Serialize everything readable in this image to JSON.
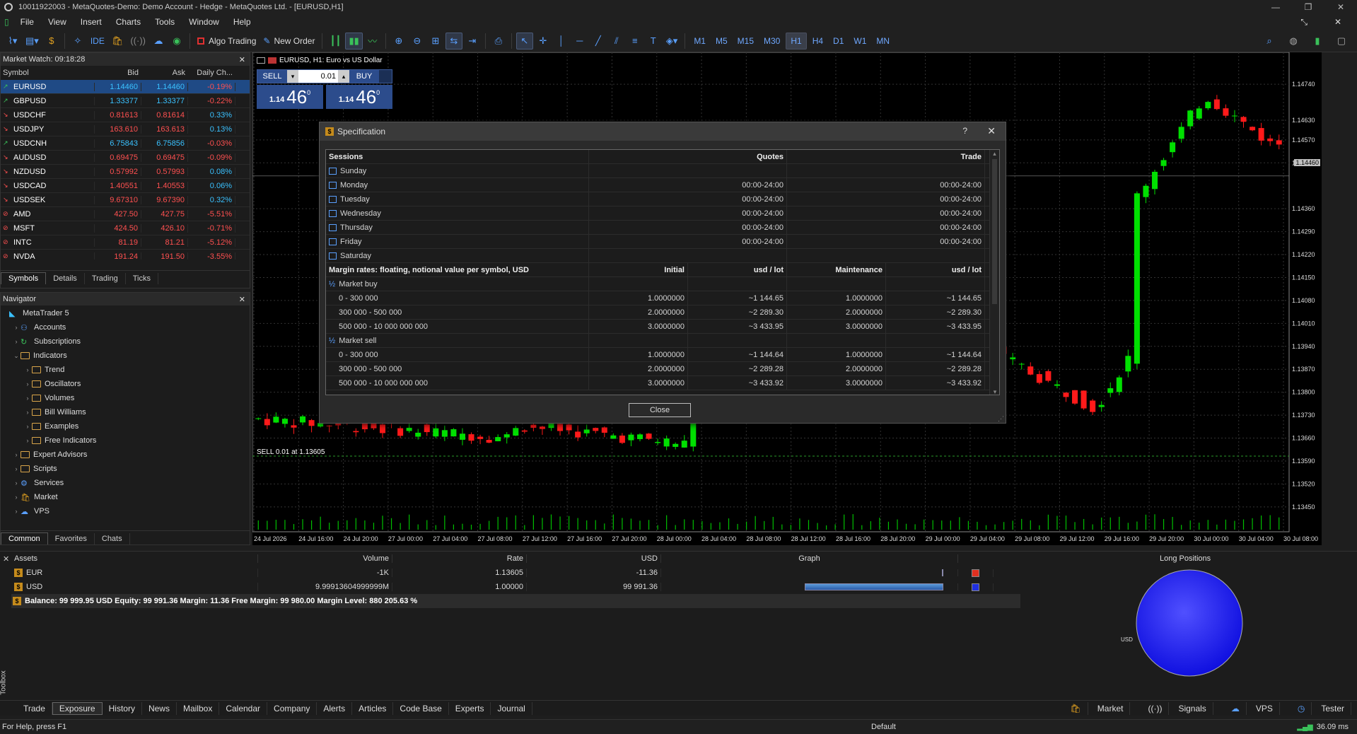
{
  "window": {
    "title": "10011922003 - MetaQuotes-Demo: Demo Account - Hedge - MetaQuotes Ltd. - [EURUSD,H1]"
  },
  "menu": [
    "File",
    "View",
    "Insert",
    "Charts",
    "Tools",
    "Window",
    "Help"
  ],
  "toolbar": {
    "algo_trading": "Algo Trading",
    "new_order": "New Order",
    "ide": "IDE",
    "timeframes": [
      "M1",
      "M5",
      "M15",
      "M30",
      "H1",
      "H4",
      "D1",
      "W1",
      "MN"
    ],
    "active_timeframe": "H1"
  },
  "market_watch": {
    "title": "Market Watch: 09:18:28",
    "columns": [
      "Symbol",
      "Bid",
      "Ask",
      "Daily Ch..."
    ],
    "rows": [
      {
        "symbol": "EURUSD",
        "bid": "1.14460",
        "ask": "1.14460",
        "change": "-0.19%",
        "dir": "up",
        "chg": "dn"
      },
      {
        "symbol": "GBPUSD",
        "bid": "1.33377",
        "ask": "1.33377",
        "change": "-0.22%",
        "dir": "up",
        "chg": "dn"
      },
      {
        "symbol": "USDCHF",
        "bid": "0.81613",
        "ask": "0.81614",
        "change": "0.33%",
        "dir": "dn",
        "chg": "up"
      },
      {
        "symbol": "USDJPY",
        "bid": "163.610",
        "ask": "163.613",
        "change": "0.13%",
        "dir": "dn",
        "chg": "up"
      },
      {
        "symbol": "USDCNH",
        "bid": "6.75843",
        "ask": "6.75856",
        "change": "-0.03%",
        "dir": "up",
        "chg": "dn"
      },
      {
        "symbol": "AUDUSD",
        "bid": "0.69475",
        "ask": "0.69475",
        "change": "-0.09%",
        "dir": "dn",
        "chg": "dn"
      },
      {
        "symbol": "NZDUSD",
        "bid": "0.57992",
        "ask": "0.57993",
        "change": "0.08%",
        "dir": "dn",
        "chg": "up"
      },
      {
        "symbol": "USDCAD",
        "bid": "1.40551",
        "ask": "1.40553",
        "change": "0.06%",
        "dir": "dn",
        "chg": "up"
      },
      {
        "symbol": "USDSEK",
        "bid": "9.67310",
        "ask": "9.67390",
        "change": "0.32%",
        "dir": "dn",
        "chg": "up"
      },
      {
        "symbol": "AMD",
        "bid": "427.50",
        "ask": "427.75",
        "change": "-5.51%",
        "dir": "stop",
        "chg": "dn"
      },
      {
        "symbol": "MSFT",
        "bid": "424.50",
        "ask": "426.10",
        "change": "-0.71%",
        "dir": "stop",
        "chg": "dn"
      },
      {
        "symbol": "INTC",
        "bid": "81.19",
        "ask": "81.21",
        "change": "-5.12%",
        "dir": "stop",
        "chg": "dn"
      },
      {
        "symbol": "NVDA",
        "bid": "191.24",
        "ask": "191.50",
        "change": "-3.55%",
        "dir": "stop",
        "chg": "dn"
      }
    ],
    "tabs": [
      "Symbols",
      "Details",
      "Trading",
      "Ticks"
    ]
  },
  "navigator": {
    "title": "Navigator",
    "items": [
      {
        "label": "MetaTrader 5",
        "depth": 0,
        "kind": "root"
      },
      {
        "label": "Accounts",
        "depth": 1,
        "kind": "accounts"
      },
      {
        "label": "Subscriptions",
        "depth": 1,
        "kind": "subs"
      },
      {
        "label": "Indicators",
        "depth": 1,
        "kind": "folder",
        "open": true
      },
      {
        "label": "Trend",
        "depth": 2,
        "kind": "folder"
      },
      {
        "label": "Oscillators",
        "depth": 2,
        "kind": "folder"
      },
      {
        "label": "Volumes",
        "depth": 2,
        "kind": "folder"
      },
      {
        "label": "Bill Williams",
        "depth": 2,
        "kind": "folder"
      },
      {
        "label": "Examples",
        "depth": 2,
        "kind": "folder"
      },
      {
        "label": "Free Indicators",
        "depth": 2,
        "kind": "folder"
      },
      {
        "label": "Expert Advisors",
        "depth": 1,
        "kind": "folder"
      },
      {
        "label": "Scripts",
        "depth": 1,
        "kind": "folder"
      },
      {
        "label": "Services",
        "depth": 1,
        "kind": "services"
      },
      {
        "label": "Market",
        "depth": 1,
        "kind": "market"
      },
      {
        "label": "VPS",
        "depth": 1,
        "kind": "vps"
      }
    ],
    "tabs": [
      "Common",
      "Favorites",
      "Chats"
    ]
  },
  "chart": {
    "label": "EURUSD, H1:  Euro vs US Dollar",
    "sell_label": "SELL",
    "buy_label": "BUY",
    "lot": "0.01",
    "sell_big": "46",
    "sell_small": "1.14",
    "sell_sup": "0",
    "buy_big": "46",
    "buy_small": "1.14",
    "buy_sup": "0",
    "position_label": "SELL 0.01 at 1.13605",
    "current_price": "1.14460",
    "price_ticks": [
      "1.14740",
      "1.14630",
      "1.14570",
      "1.14500",
      "1.14460",
      "1.14360",
      "1.14290",
      "1.14220",
      "1.14150",
      "1.14080",
      "1.14010",
      "1.13940",
      "1.13870",
      "1.13800",
      "1.13730",
      "1.13660",
      "1.13590",
      "1.13520",
      "1.13450"
    ],
    "time_ticks": [
      "24 Jul 2026",
      "24 Jul 16:00",
      "24 Jul 20:00",
      "27 Jul 00:00",
      "27 Jul 04:00",
      "27 Jul 08:00",
      "27 Jul 12:00",
      "27 Jul 16:00",
      "27 Jul 20:00",
      "28 Jul 00:00",
      "28 Jul 04:00",
      "28 Jul 08:00",
      "28 Jul 12:00",
      "28 Jul 16:00",
      "28 Jul 20:00",
      "29 Jul 00:00",
      "29 Jul 04:00",
      "29 Jul 08:00",
      "29 Jul 12:00",
      "29 Jul 16:00",
      "29 Jul 20:00",
      "30 Jul 00:00",
      "30 Jul 04:00",
      "30 Jul 08:00"
    ],
    "colors": {
      "bull": "#00e000",
      "bear": "#ff1a1a"
    }
  },
  "spec_dialog": {
    "title": "Specification",
    "help": "?",
    "sessions_header": [
      "Sessions",
      "Quotes",
      "Trade"
    ],
    "sessions": [
      {
        "day": "Sunday",
        "quotes": "",
        "trade": ""
      },
      {
        "day": "Monday",
        "quotes": "00:00-24:00",
        "trade": "00:00-24:00"
      },
      {
        "day": "Tuesday",
        "quotes": "00:00-24:00",
        "trade": "00:00-24:00"
      },
      {
        "day": "Wednesday",
        "quotes": "00:00-24:00",
        "trade": "00:00-24:00"
      },
      {
        "day": "Thursday",
        "quotes": "00:00-24:00",
        "trade": "00:00-24:00"
      },
      {
        "day": "Friday",
        "quotes": "00:00-24:00",
        "trade": "00:00-24:00"
      },
      {
        "day": "Saturday",
        "quotes": "",
        "trade": ""
      }
    ],
    "margin_header": [
      "Margin rates: floating, notional value per symbol, USD",
      "Initial",
      "usd / lot",
      "Maintenance",
      "usd / lot"
    ],
    "margin_groups": [
      {
        "name": "Market buy",
        "rows": [
          [
            "0 - 300 000",
            "1.0000000",
            "~1 144.65",
            "1.0000000",
            "~1 144.65"
          ],
          [
            "300 000 - 500 000",
            "2.0000000",
            "~2 289.30",
            "2.0000000",
            "~2 289.30"
          ],
          [
            "500 000 - 10 000 000 000",
            "3.0000000",
            "~3 433.95",
            "3.0000000",
            "~3 433.95"
          ]
        ]
      },
      {
        "name": "Market sell",
        "rows": [
          [
            "0 - 300 000",
            "1.0000000",
            "~1 144.64",
            "1.0000000",
            "~1 144.64"
          ],
          [
            "300 000 - 500 000",
            "2.0000000",
            "~2 289.28",
            "2.0000000",
            "~2 289.28"
          ],
          [
            "500 000 - 10 000 000 000",
            "3.0000000",
            "~3 433.92",
            "3.0000000",
            "~3 433.92"
          ]
        ]
      }
    ],
    "close_label": "Close"
  },
  "exposure": {
    "columns": [
      "Assets",
      "Volume",
      "Rate",
      "USD",
      "Graph"
    ],
    "rows": [
      {
        "asset": "EUR",
        "volume": "-1K",
        "rate": "1.13605",
        "usd": "-11.36",
        "color": "#e03020",
        "bar": 0
      },
      {
        "asset": "USD",
        "volume": "9.99913604999999M",
        "rate": "1.00000",
        "usd": "99 991.36",
        "color": "#2030e0",
        "bar": 1
      }
    ],
    "summary": "Balance: 99 999.95 USD  Equity: 99 991.36  Margin: 11.36  Free Margin: 99 980.00  Margin Level: 880 205.63 %",
    "long_positions_title": "Long Positions",
    "pie_label": "USD"
  },
  "toolbox_label": "Toolbox",
  "bottom_tabs": [
    "Trade",
    "Exposure",
    "History",
    "News",
    "Mailbox",
    "Calendar",
    "Company",
    "Alerts",
    "Articles",
    "Code Base",
    "Experts",
    "Journal"
  ],
  "active_bottom_tab": "Exposure",
  "bottom_right": [
    "Market",
    "Signals",
    "VPS",
    "Tester"
  ],
  "status": {
    "help": "For Help, press F1",
    "profile": "Default",
    "ping": "36.09 ms"
  }
}
